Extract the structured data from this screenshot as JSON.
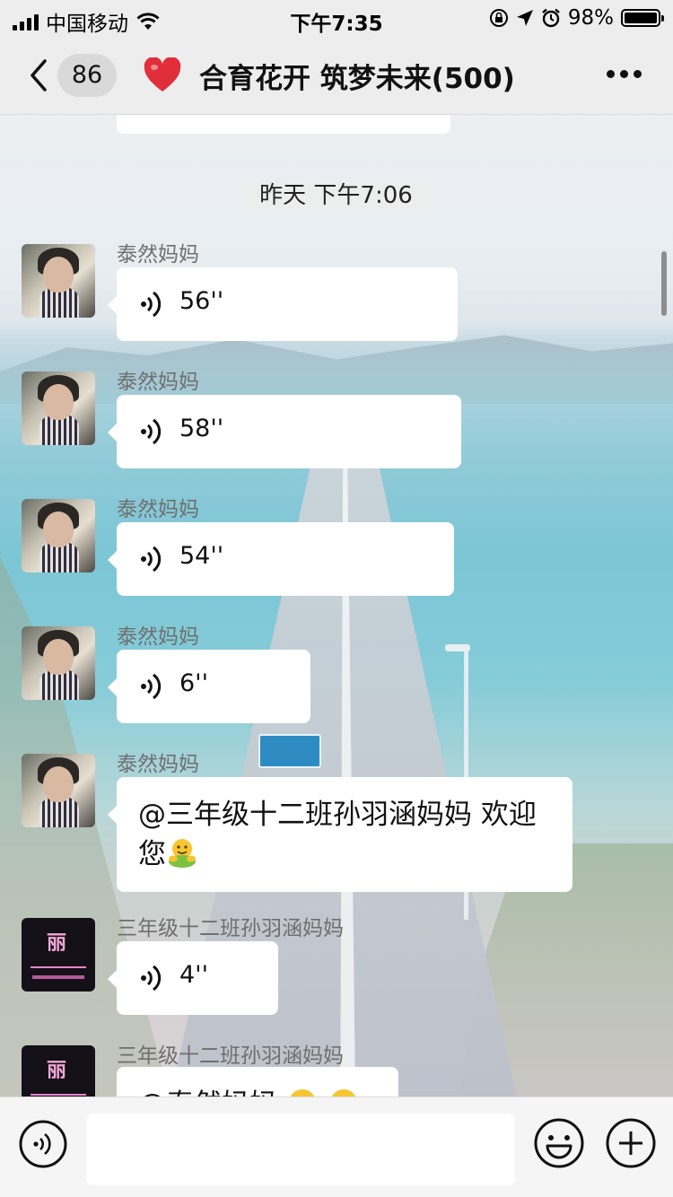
{
  "status_bar": {
    "carrier": "中国移动",
    "time": "下午7:35",
    "battery": "98%"
  },
  "nav": {
    "unread_count": "86",
    "title": "合育花开 筑梦未来(500)"
  },
  "chat": {
    "timestamp": "昨天 下午7:06",
    "messages": [
      {
        "sender": "泰然妈妈",
        "type": "voice",
        "duration": "56''"
      },
      {
        "sender": "泰然妈妈",
        "type": "voice",
        "duration": "58''"
      },
      {
        "sender": "泰然妈妈",
        "type": "voice",
        "duration": "54''"
      },
      {
        "sender": "泰然妈妈",
        "type": "voice",
        "duration": "6''"
      },
      {
        "sender": "泰然妈妈",
        "type": "text",
        "text": "@三年级十二班孙羽涵妈妈 欢迎您",
        "emoji": "hug-emoji"
      },
      {
        "sender": "三年级十二班孙羽涵妈妈",
        "type": "voice",
        "duration": "4''",
        "avatar_text": "丽"
      },
      {
        "sender": "三年级十二班孙羽涵妈妈",
        "type": "text",
        "text": "@泰然妈妈",
        "avatar_text": "丽",
        "emoji": "smile-emoji"
      }
    ]
  },
  "input_bar": {
    "placeholder": ""
  },
  "colors": {
    "bubble": "#ffffff",
    "nav_bg": "#ededed",
    "sender_text": "#6f6f6f",
    "heart": "#e02f3a",
    "emoji": "#7cc142"
  }
}
